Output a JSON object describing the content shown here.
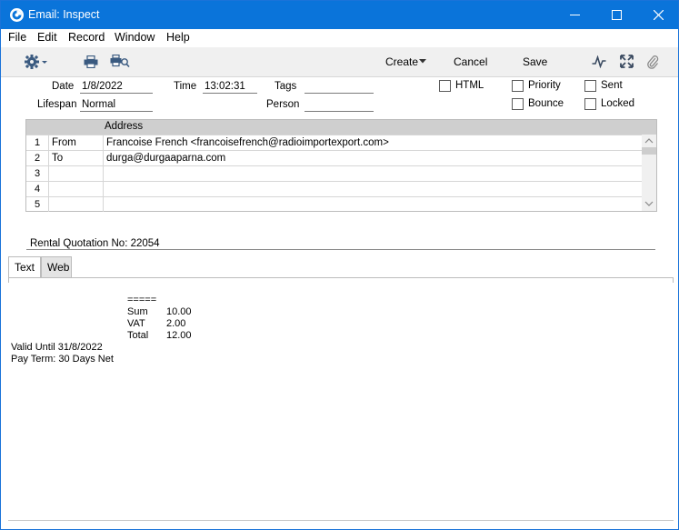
{
  "window": {
    "title": "Email: Inspect"
  },
  "menu": [
    "File",
    "Edit",
    "Record",
    "Window",
    "Help"
  ],
  "toolbar": {
    "create": "Create",
    "cancel": "Cancel",
    "save": "Save"
  },
  "header": {
    "date_label": "Date",
    "date_value": "1/8/2022",
    "time_label": "Time",
    "time_value": "13:02:31",
    "tags_label": "Tags",
    "tags_value": "",
    "lifespan_label": "Lifespan",
    "lifespan_value": "Normal",
    "person_label": "Person",
    "person_value": "",
    "checkboxes": {
      "html": "HTML",
      "priority": "Priority",
      "sent": "Sent",
      "bounce": "Bounce",
      "locked": "Locked"
    }
  },
  "grid": {
    "column_header": "Address",
    "rows": [
      {
        "num": "1",
        "type": "From",
        "address": "Francoise French <francoisefrench@radioimportexport.com>"
      },
      {
        "num": "2",
        "type": "To",
        "address": "durga@durgaaparna.com"
      },
      {
        "num": "3",
        "type": "",
        "address": ""
      },
      {
        "num": "4",
        "type": "",
        "address": ""
      },
      {
        "num": "5",
        "type": "",
        "address": ""
      }
    ]
  },
  "subject": "Rental Quotation No: 22054",
  "tabs": [
    "Text",
    "Web"
  ],
  "body": {
    "line_eq": "=====",
    "sum_label": "Sum",
    "sum_value": "10.00",
    "vat_label": "VAT",
    "vat_value": "2.00",
    "total_label": "Total",
    "total_value": "12.00",
    "valid_until": "Valid Until 31/8/2022",
    "pay_term": "Pay Term: 30 Days Net"
  }
}
